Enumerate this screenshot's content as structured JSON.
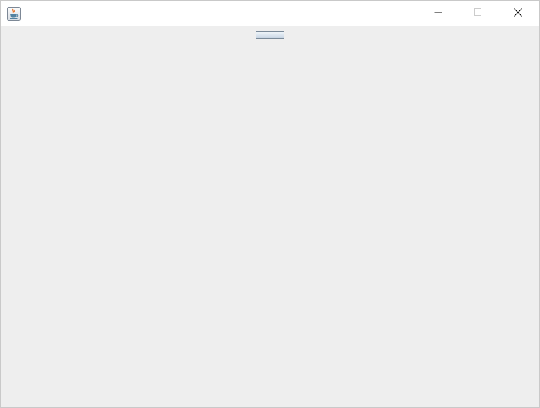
{
  "window": {
    "title": "",
    "icon": "java-coffee-cup-icon",
    "controls": {
      "minimize_icon": "minimize-icon",
      "maximize_icon": "maximize-icon",
      "close_icon": "close-icon"
    }
  },
  "content": {
    "background": "#eeeeee",
    "button": {
      "label": ""
    }
  }
}
